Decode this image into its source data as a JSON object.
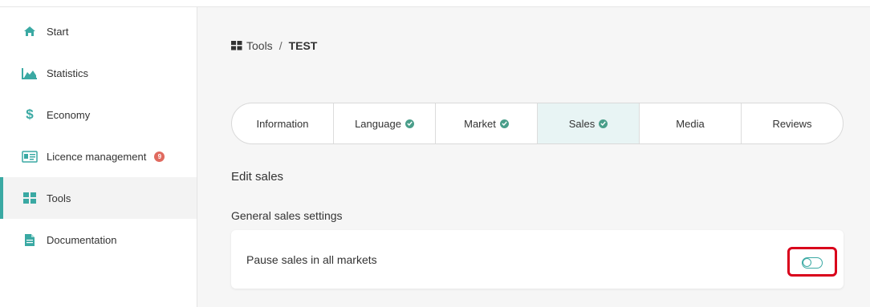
{
  "sidebar": {
    "items": [
      {
        "label": "Start",
        "icon": "home-icon"
      },
      {
        "label": "Statistics",
        "icon": "area-chart-icon"
      },
      {
        "label": "Economy",
        "icon": "dollar-icon"
      },
      {
        "label": "Licence management",
        "icon": "id-card-icon",
        "badge": "9"
      },
      {
        "label": "Tools",
        "icon": "grid-icon",
        "active": true
      },
      {
        "label": "Documentation",
        "icon": "document-icon"
      }
    ]
  },
  "breadcrumb": {
    "parent": "Tools",
    "separator": "/",
    "current": "TEST"
  },
  "tabs": [
    {
      "label": "Information",
      "checked": false
    },
    {
      "label": "Language",
      "checked": true
    },
    {
      "label": "Market",
      "checked": true
    },
    {
      "label": "Sales",
      "checked": true,
      "active": true
    },
    {
      "label": "Media",
      "checked": false
    },
    {
      "label": "Reviews",
      "checked": false
    }
  ],
  "content": {
    "section_title": "Edit sales",
    "subsection_title": "General sales settings",
    "setting_label": "Pause sales in all markets",
    "toggle_on": false
  },
  "colors": {
    "accent": "#3aa9a3",
    "badge": "#e06a5f",
    "check": "#4a9e8a",
    "highlight": "#d9001b",
    "active_tab_bg": "#e8f4f4"
  }
}
